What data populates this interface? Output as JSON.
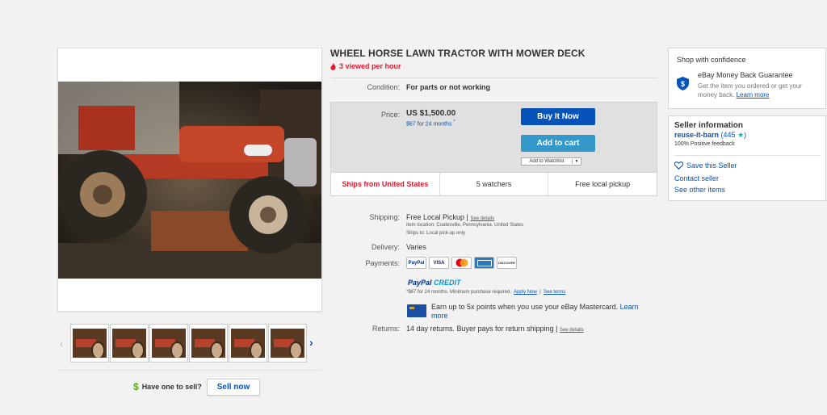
{
  "item": {
    "title": "WHEEL HORSE LAWN TRACTOR WITH MOWER DECK",
    "viewed": "3 viewed per hour",
    "condition_label": "Condition:",
    "condition_value": "For parts or not working"
  },
  "price": {
    "label": "Price:",
    "value": "US $1,500.00",
    "monthly": "$67 for 24 months",
    "buy_label": "Buy It Now",
    "cart_label": "Add to cart",
    "watch_label": "Add to Watchlist"
  },
  "strip": {
    "ships_from": "Ships from United States",
    "watchers": "5 watchers",
    "pickup": "Free local pickup"
  },
  "shipping": {
    "label": "Shipping:",
    "value": "Free Local Pickup",
    "see_details": "See details",
    "item_location": "Item location:  Coatesville, Pennsylvania, United States",
    "ships_to": "Ships to:  Local pick-up only"
  },
  "delivery": {
    "label": "Delivery:",
    "value": "Varies"
  },
  "payments": {
    "label": "Payments:",
    "methods": [
      "PayPal",
      "VISA",
      "Mastercard",
      "AMEX",
      "DISCOVER"
    ],
    "paypal_credit_a": "PayPal",
    "paypal_credit_b": "CREDIT",
    "credit_note": "*$67 for 24 months. Minimum purchase required.",
    "apply_now": "Apply Now",
    "see_terms": "See terms",
    "mastercard_text": "Earn up to 5x points when you use your eBay Mastercard.",
    "learn_more": "Learn more"
  },
  "returns": {
    "label": "Returns:",
    "value": "14 day returns. Buyer pays for return shipping",
    "see_details": "See details"
  },
  "sell": {
    "question": "Have one to sell?",
    "button": "Sell now",
    "dollar": "$"
  },
  "confidence": {
    "title": "Shop with confidence",
    "guarantee_title": "eBay Money Back Guarantee",
    "guarantee_desc": "Get the item you ordered or get your money back.",
    "learn_more": "Learn more"
  },
  "seller": {
    "title": "Seller information",
    "name": "reuse-it-barn",
    "score": "(445",
    "feedback": "100% Positive feedback",
    "save": "Save this Seller",
    "contact": "Contact seller",
    "other": "See other items"
  },
  "colors": {
    "brand_blue": "#0654ba",
    "cart_blue": "#3498ca",
    "alert_red": "#dd1e31"
  },
  "thumbnail_count": 6
}
